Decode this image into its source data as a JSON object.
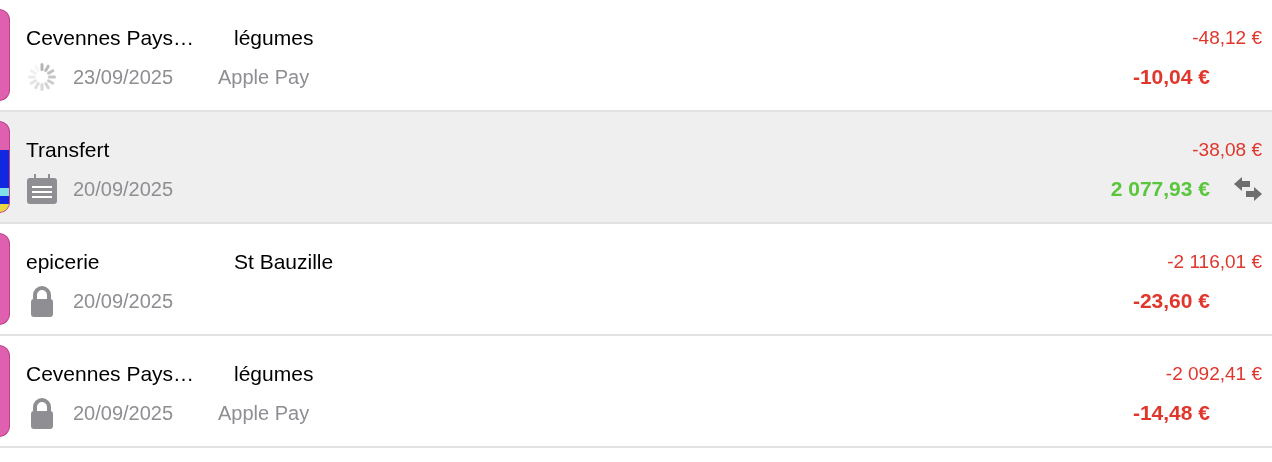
{
  "transactions": [
    {
      "payee": "Cevennes Pays…",
      "category": "légumes",
      "kind": "pending",
      "date": "23/09/2025",
      "method": "Apple Pay",
      "balance": "-48,12 €",
      "amount": {
        "text": "-10,04 €",
        "kind": "debit"
      },
      "transfer": false,
      "selected": false,
      "color": "#e060b0"
    },
    {
      "payee": "Transfert",
      "kind": "scheduled",
      "date": "20/09/2025",
      "balance": "-38,08 €",
      "amount": {
        "text": "2 077,93 €",
        "kind": "credit"
      },
      "transfer": true,
      "selected": true,
      "color": "#e060b0",
      "bands": [
        {
          "color": "#1028e0"
        },
        {
          "color": "#80e0e8"
        },
        {
          "color": "#1028e0"
        },
        {
          "color": "#e8d840"
        }
      ]
    },
    {
      "payee": "epicerie",
      "category": "St Bauzille",
      "kind": "locked",
      "date": "20/09/2025",
      "balance": "-2 116,01 €",
      "amount": {
        "text": "-23,60 €",
        "kind": "debit"
      },
      "transfer": false,
      "selected": false,
      "color": "#e060b0"
    },
    {
      "payee": "Cevennes Pays…",
      "category": "légumes",
      "kind": "locked",
      "date": "20/09/2025",
      "method": "Apple Pay",
      "balance": "-2 092,41 €",
      "amount": {
        "text": "-14,48 €",
        "kind": "debit"
      },
      "transfer": false,
      "selected": false,
      "color": "#e060b0"
    }
  ]
}
